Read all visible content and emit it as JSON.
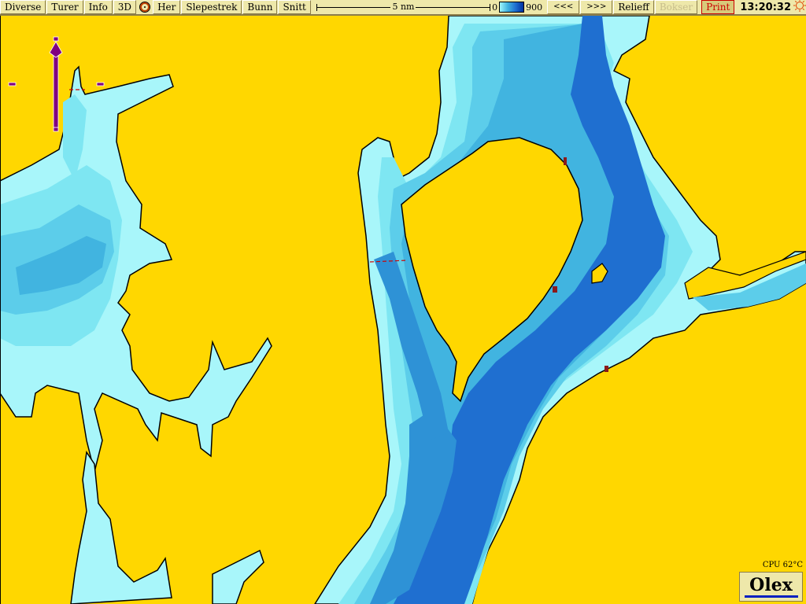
{
  "toolbar": {
    "buttons": [
      {
        "label": "Diverse"
      },
      {
        "label": "Turer"
      },
      {
        "label": "Info"
      },
      {
        "label": "3D"
      },
      {
        "label": "Her"
      },
      {
        "label": "Slepestrek"
      },
      {
        "label": "Bunn"
      },
      {
        "label": "Snitt"
      }
    ],
    "target_icon": "target-icon",
    "scale_label": "5 nm",
    "depth_min": "0",
    "depth_max": "900",
    "nav_back": "<<<",
    "nav_fwd": ">>>",
    "relief": "Relieff",
    "bokser": "Bokser",
    "print": "Print",
    "clock": "13:20:32",
    "sun_icon": "sun-icon"
  },
  "status": {
    "cpu": "CPU 62°C"
  },
  "logo": {
    "text": "Olex"
  },
  "map": {
    "colors": {
      "land": "#FFD700",
      "shallow": "#A8F6FA",
      "shallow2": "#7EE6F2",
      "mid": "#5CCDEA",
      "mid2": "#41B4E0",
      "deep": "#2E92D6",
      "deeper": "#1F6FD0",
      "deepest": "#1560C8",
      "coast": "#000000",
      "marker": "#800080",
      "track": "#D00000"
    }
  }
}
